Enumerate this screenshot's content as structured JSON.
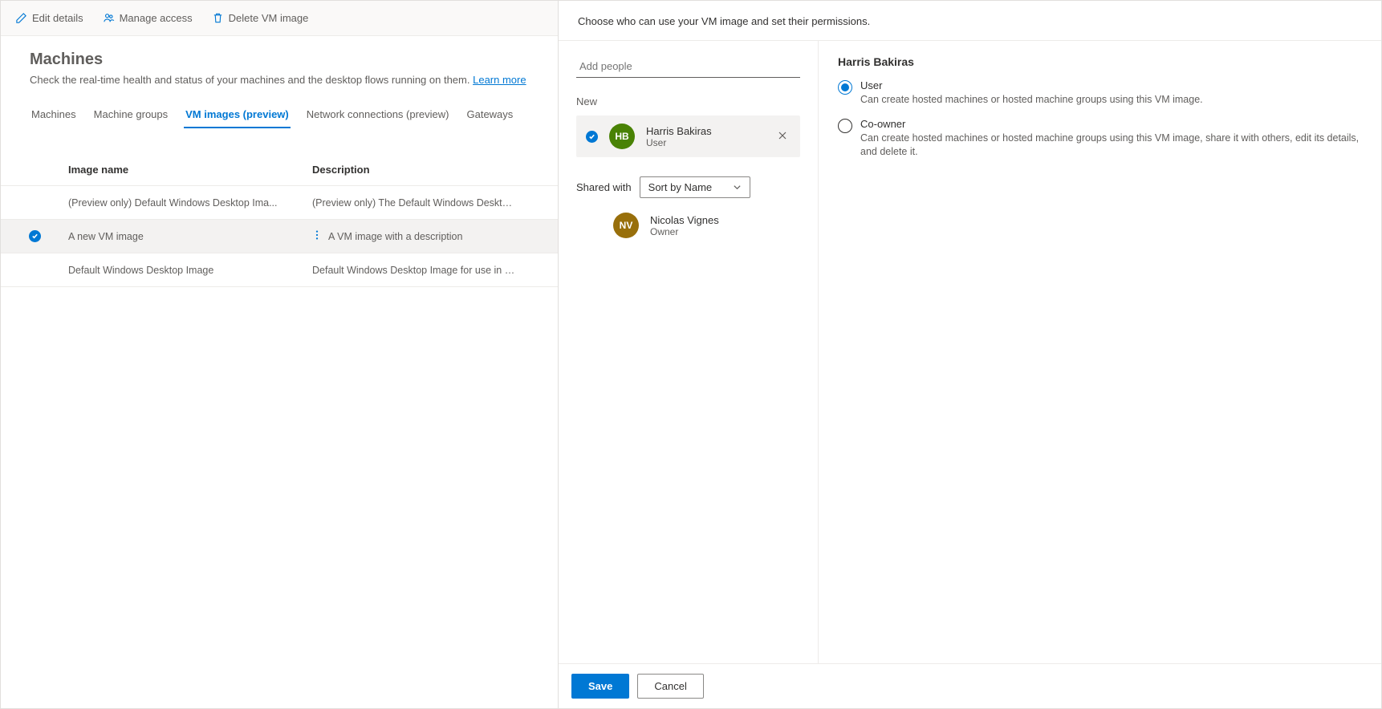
{
  "toolbar": {
    "edit": "Edit details",
    "manage": "Manage access",
    "delete": "Delete VM image"
  },
  "page": {
    "title": "Machines",
    "subtitle": "Check the real-time health and status of your machines and the desktop flows running on them.",
    "learn_more": "Learn more"
  },
  "tabs": {
    "machines": "Machines",
    "groups": "Machine groups",
    "vm": "VM images (preview)",
    "network": "Network connections (preview)",
    "gateways": "Gateways"
  },
  "table": {
    "col_name": "Image name",
    "col_desc": "Description",
    "rows": [
      {
        "name": "(Preview only) Default Windows Desktop Ima...",
        "desc": "(Preview only) The Default Windows Desktop Image for use i...",
        "selected": false
      },
      {
        "name": "A new VM image",
        "desc": "A VM image with a description",
        "selected": true
      },
      {
        "name": "Default Windows Desktop Image",
        "desc": "Default Windows Desktop Image for use in Microsoft Deskto...",
        "selected": false
      }
    ]
  },
  "panel": {
    "header": "Choose who can use your VM image and set their permissions.",
    "add_placeholder": "Add people",
    "new_label": "New",
    "new_person": {
      "initials": "HB",
      "name": "Harris Bakiras",
      "role": "User"
    },
    "shared_with": "Shared with",
    "sort_by": "Sort by Name",
    "owner": {
      "initials": "NV",
      "name": "Nicolas Vignes",
      "role": "Owner"
    },
    "right_title": "Harris Bakiras",
    "perm_user": {
      "label": "User",
      "desc": "Can create hosted machines or hosted machine groups using this VM image."
    },
    "perm_coowner": {
      "label": "Co-owner",
      "desc": "Can create hosted machines or hosted machine groups using this VM image, share it with others, edit its details, and delete it."
    },
    "save": "Save",
    "cancel": "Cancel"
  }
}
